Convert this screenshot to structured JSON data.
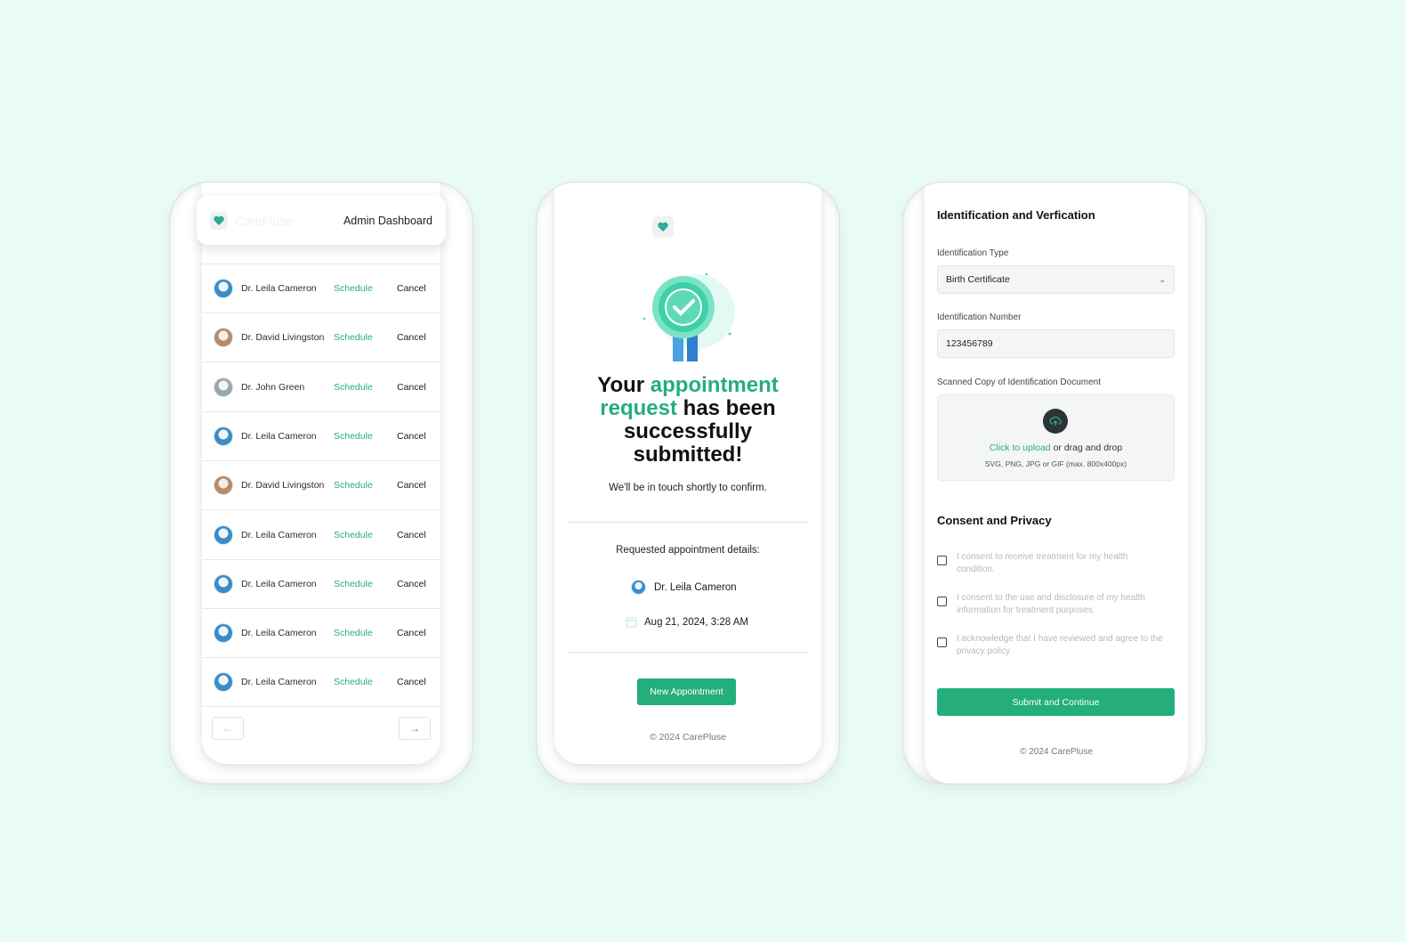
{
  "admin": {
    "brand": "CarePluse",
    "title": "Admin Dashboard",
    "rows": [
      {
        "name": "Dr. Leila Cameron",
        "schedule": "Schedule",
        "cancel": "Cancel"
      },
      {
        "name": "Dr. David Livingston",
        "schedule": "Schedule",
        "cancel": "Cancel"
      },
      {
        "name": "Dr. John Green",
        "schedule": "Schedule",
        "cancel": "Cancel"
      },
      {
        "name": "Dr. Leila Cameron",
        "schedule": "Schedule",
        "cancel": "Cancel"
      },
      {
        "name": "Dr. David Livingston",
        "schedule": "Schedule",
        "cancel": "Cancel"
      },
      {
        "name": "Dr. Leila Cameron",
        "schedule": "Schedule",
        "cancel": "Cancel"
      },
      {
        "name": "Dr. Leila Cameron",
        "schedule": "Schedule",
        "cancel": "Cancel"
      },
      {
        "name": "Dr. Leila Cameron",
        "schedule": "Schedule",
        "cancel": "Cancel"
      },
      {
        "name": "Dr. Leila Cameron",
        "schedule": "Schedule",
        "cancel": "Cancel"
      }
    ],
    "prev_icon": "arrow-left-icon",
    "next_icon": "arrow-right-icon"
  },
  "success": {
    "heading_1": "Your ",
    "heading_green": "appointment request",
    "heading_2": " has been successfully submitted!",
    "subtitle": "We'll be in touch shortly to confirm.",
    "details_label": "Requested appointment details:",
    "doctor": "Dr. Leila Cameron",
    "date": "Aug 21, 2024, 3:28 AM",
    "button": "New Appointment",
    "footer": "© 2024 CarePluse"
  },
  "register": {
    "section_title": "Identification and Verfication",
    "id_type_label": "Identification Type",
    "id_type_value": "Birth Certificate",
    "id_number_label": "Identification Number",
    "id_number_value": "123456789",
    "scan_label": "Scanned Copy of Identification Document",
    "upload_link": "Click to upload",
    "upload_rest": " or drag and drop",
    "upload_hint": "SVG, PNG, JPG or GIF (max. 800x400px)",
    "consent_title": "Consent and Privacy",
    "consents": [
      "I consent to receive treatment for my health condition.",
      "I consent to the use and disclosure of my health information for treatment purposes.",
      "I acknowledge that I have reviewed and agree to the privacy policy"
    ],
    "submit": "Submit and Continue",
    "footer": "© 2024 CarePluse"
  },
  "colors": {
    "accent": "#24ae7c",
    "background": "#e8fcf5"
  }
}
